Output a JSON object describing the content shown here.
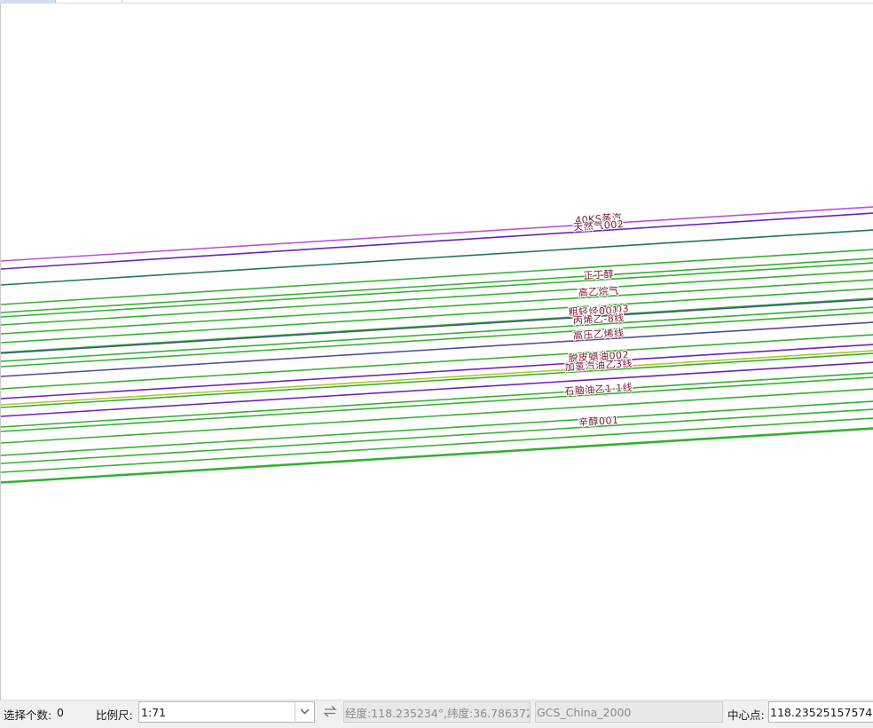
{
  "map": {
    "pipelines": [
      {
        "color": "#c04ed1",
        "label": "40KS蒸汽"
      },
      {
        "color": "#6a22b8",
        "label": "天然气002"
      },
      {
        "color": "#1d7560",
        "label": ""
      },
      {
        "color": "#32b12e",
        "label": ""
      },
      {
        "color": "#32b12e",
        "label": ""
      },
      {
        "color": "#32b12e",
        "label": "正丁醇"
      },
      {
        "color": "#32b12e",
        "label": ""
      },
      {
        "color": "#32b12e",
        "label": "高乙烷气"
      },
      {
        "color": "#32b12e",
        "label": ""
      },
      {
        "color": "#32b12e",
        "label": "粗二甲苯003"
      },
      {
        "color": "#3a5f73",
        "label": "轻烃001"
      },
      {
        "color": "#32b12e",
        "label": "丙烯乙-8线"
      },
      {
        "color": "#32b12e",
        "label": ""
      },
      {
        "color": "#4d4d95",
        "label": "高压乙烯线"
      },
      {
        "color": "#32b12e",
        "label": ""
      },
      {
        "color": "#6a22b8",
        "label": "脱皮蜡油002"
      },
      {
        "color": "#b3c42a",
        "label": ""
      },
      {
        "color": "#32b12e",
        "label": "加氢汽油乙3线"
      },
      {
        "color": "#6a22b8",
        "label": ""
      },
      {
        "color": "#32b12e",
        "label": ""
      },
      {
        "color": "#32b12e",
        "label": "石脑油乙1-1线"
      },
      {
        "color": "#32b12e",
        "label": ""
      },
      {
        "color": "#32b12e",
        "label": ""
      },
      {
        "color": "#32b12e",
        "label": "辛醇001"
      },
      {
        "color": "#32b12e",
        "label": ""
      },
      {
        "color": "#32b12e",
        "label": ""
      },
      {
        "color": "#32b12e",
        "label": ""
      }
    ]
  },
  "status_bar": {
    "selection_count_label": "选择个数:",
    "selection_count_value": "0",
    "scale_label": "比例尺:",
    "scale_value": "1:71",
    "coordinates_value": "经度:118.235234°,纬度:36.786372",
    "crs_value": "GCS_China_2000",
    "center_label": "中心点:",
    "center_value": "118.23525157574"
  },
  "icons": {
    "scale_dropdown": "chevron-down-icon",
    "coordinate_swap": "swap-arrows-icon"
  }
}
